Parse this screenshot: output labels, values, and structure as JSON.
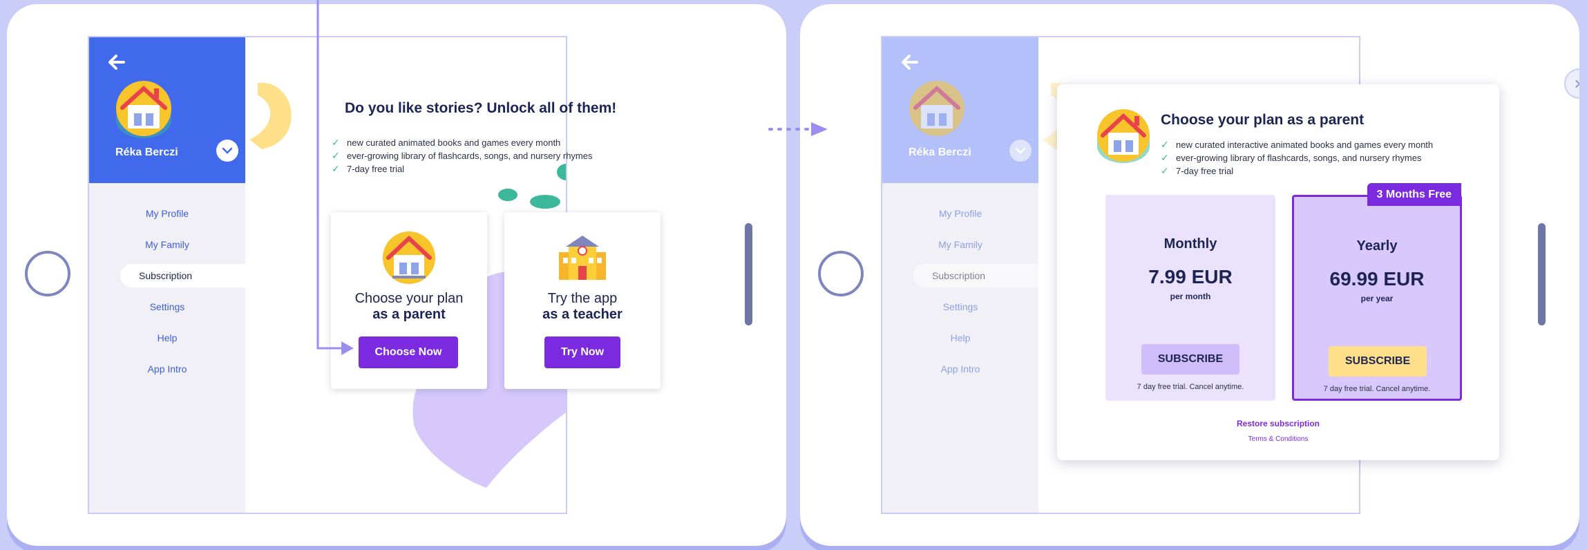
{
  "colors": {
    "background": "#c9cdf7",
    "primary_blue": "#4169ec",
    "purple": "#7b2ae0",
    "teal": "#3bb89a",
    "yellow": "#ffe08a",
    "dark_text": "#1d2455"
  },
  "left_screen": {
    "profile": {
      "name": "Réka Berczi"
    },
    "nav": [
      "My Profile",
      "My Family",
      "Subscription",
      "Settings",
      "Help",
      "App Intro"
    ],
    "active_nav": "Subscription",
    "headline": "Do you like stories? Unlock all of them!",
    "features": [
      "new curated animated books and games every month",
      "ever-growing library of flashcards, songs, and nursery rhymes",
      "7-day free trial"
    ],
    "cards": [
      {
        "line1": "Choose your plan",
        "line2": "as a parent",
        "button": "Choose Now",
        "icon": "house-icon"
      },
      {
        "line1": "Try the app",
        "line2": "as a teacher",
        "button": "Try Now",
        "icon": "school-icon"
      }
    ]
  },
  "right_screen": {
    "profile": {
      "name": "Réka Berczi"
    },
    "nav": [
      "My Profile",
      "My Family",
      "Subscription",
      "Settings",
      "Help",
      "App Intro"
    ],
    "modal": {
      "title": "Choose your plan as a parent",
      "features": [
        "new curated interactive animated books and games every month",
        "ever-growing library of flashcards, songs, and nursery rhymes",
        "7-day free trial"
      ],
      "plans": [
        {
          "name": "Monthly",
          "price": "7.99 EUR",
          "period": "per month",
          "button": "SUBSCRIBE",
          "note": "7 day free trial. Cancel anytime."
        },
        {
          "name": "Yearly",
          "price": "69.99 EUR",
          "period": "per year",
          "button": "SUBSCRIBE",
          "note": "7 day free trial. Cancel anytime.",
          "badge": "3 Months Free"
        }
      ],
      "restore": "Restore subscription",
      "terms": "Terms & Conditions",
      "close_icon": "close-icon"
    }
  }
}
